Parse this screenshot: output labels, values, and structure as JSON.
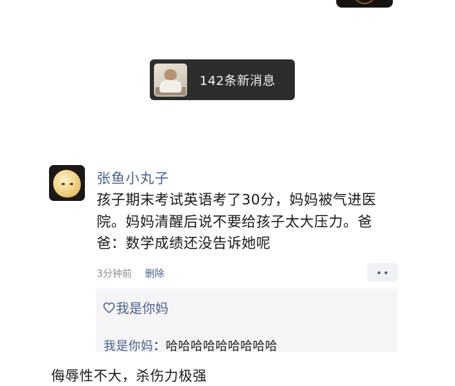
{
  "banner": {
    "new_messages": "142条新消息"
  },
  "comment": {
    "author": "张鱼小丸子",
    "text": "孩子期末考试英语考了30分，妈妈被气进医院。妈妈清醒后说不要给孩子太大压力。爸爸：数学成绩还没告诉她呢",
    "time": "3分钟前",
    "delete_label": "删除"
  },
  "likes": {
    "icon": "heart-icon",
    "label": "我是你妈"
  },
  "reply": {
    "author": "我是你妈",
    "separator": "：",
    "text": "哈哈哈哈哈哈哈哈哈"
  },
  "caption": "侮辱性不大，杀伤力极强",
  "colors": {
    "link": "#4b5f8a",
    "pill_bg": "#2d2d2d",
    "reply_bg": "#f5f5f7"
  }
}
